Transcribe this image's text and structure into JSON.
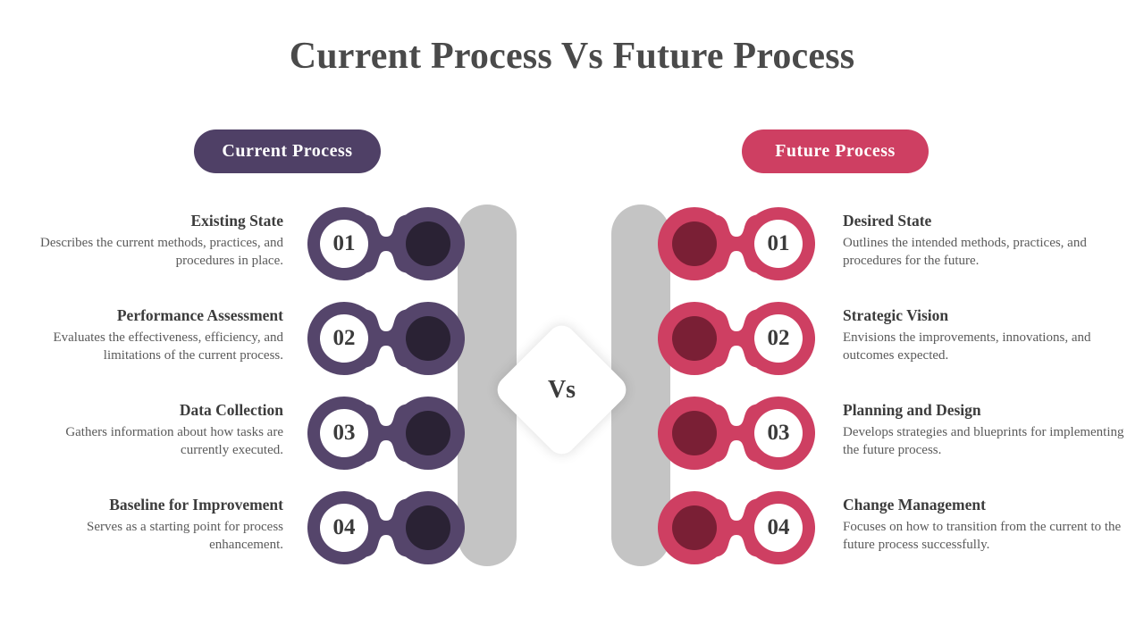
{
  "title": "Current Process Vs Future Process",
  "center": {
    "vs_label": "Vs"
  },
  "colors": {
    "title_text": "#4a4a4a",
    "left_accent": "#4f4066",
    "left_shape": "#55456b",
    "left_inner": "#2a2234",
    "right_accent": "#ce3f62",
    "right_shape": "#ce3f62",
    "right_inner": "#7a1f35",
    "center_bar": "#c4c4c4",
    "background": "#ffffff"
  },
  "left": {
    "badge": "Current  Process",
    "items": [
      {
        "number": "01",
        "heading": "Existing State",
        "body": "Describes the current methods, practices, and procedures in place."
      },
      {
        "number": "02",
        "heading": "Performance Assessment",
        "body": "Evaluates the effectiveness, efficiency, and limitations of the current process."
      },
      {
        "number": "03",
        "heading": "Data Collection",
        "body": "Gathers information about how tasks are currently executed."
      },
      {
        "number": "04",
        "heading": "Baseline for Improvement",
        "body": "Serves as a starting point for process enhancement."
      }
    ]
  },
  "right": {
    "badge": "Future Process",
    "items": [
      {
        "number": "01",
        "heading": "Desired State",
        "body": "Outlines the intended methods, practices, and procedures for the future."
      },
      {
        "number": "02",
        "heading": "Strategic Vision",
        "body": "Envisions the improvements, innovations, and outcomes expected."
      },
      {
        "number": "03",
        "heading": "Planning and Design",
        "body": "Develops strategies and blueprints for implementing the future process."
      },
      {
        "number": "04",
        "heading": "Change Management",
        "body": "Focuses on how to transition from the current to the future process successfully."
      }
    ]
  }
}
